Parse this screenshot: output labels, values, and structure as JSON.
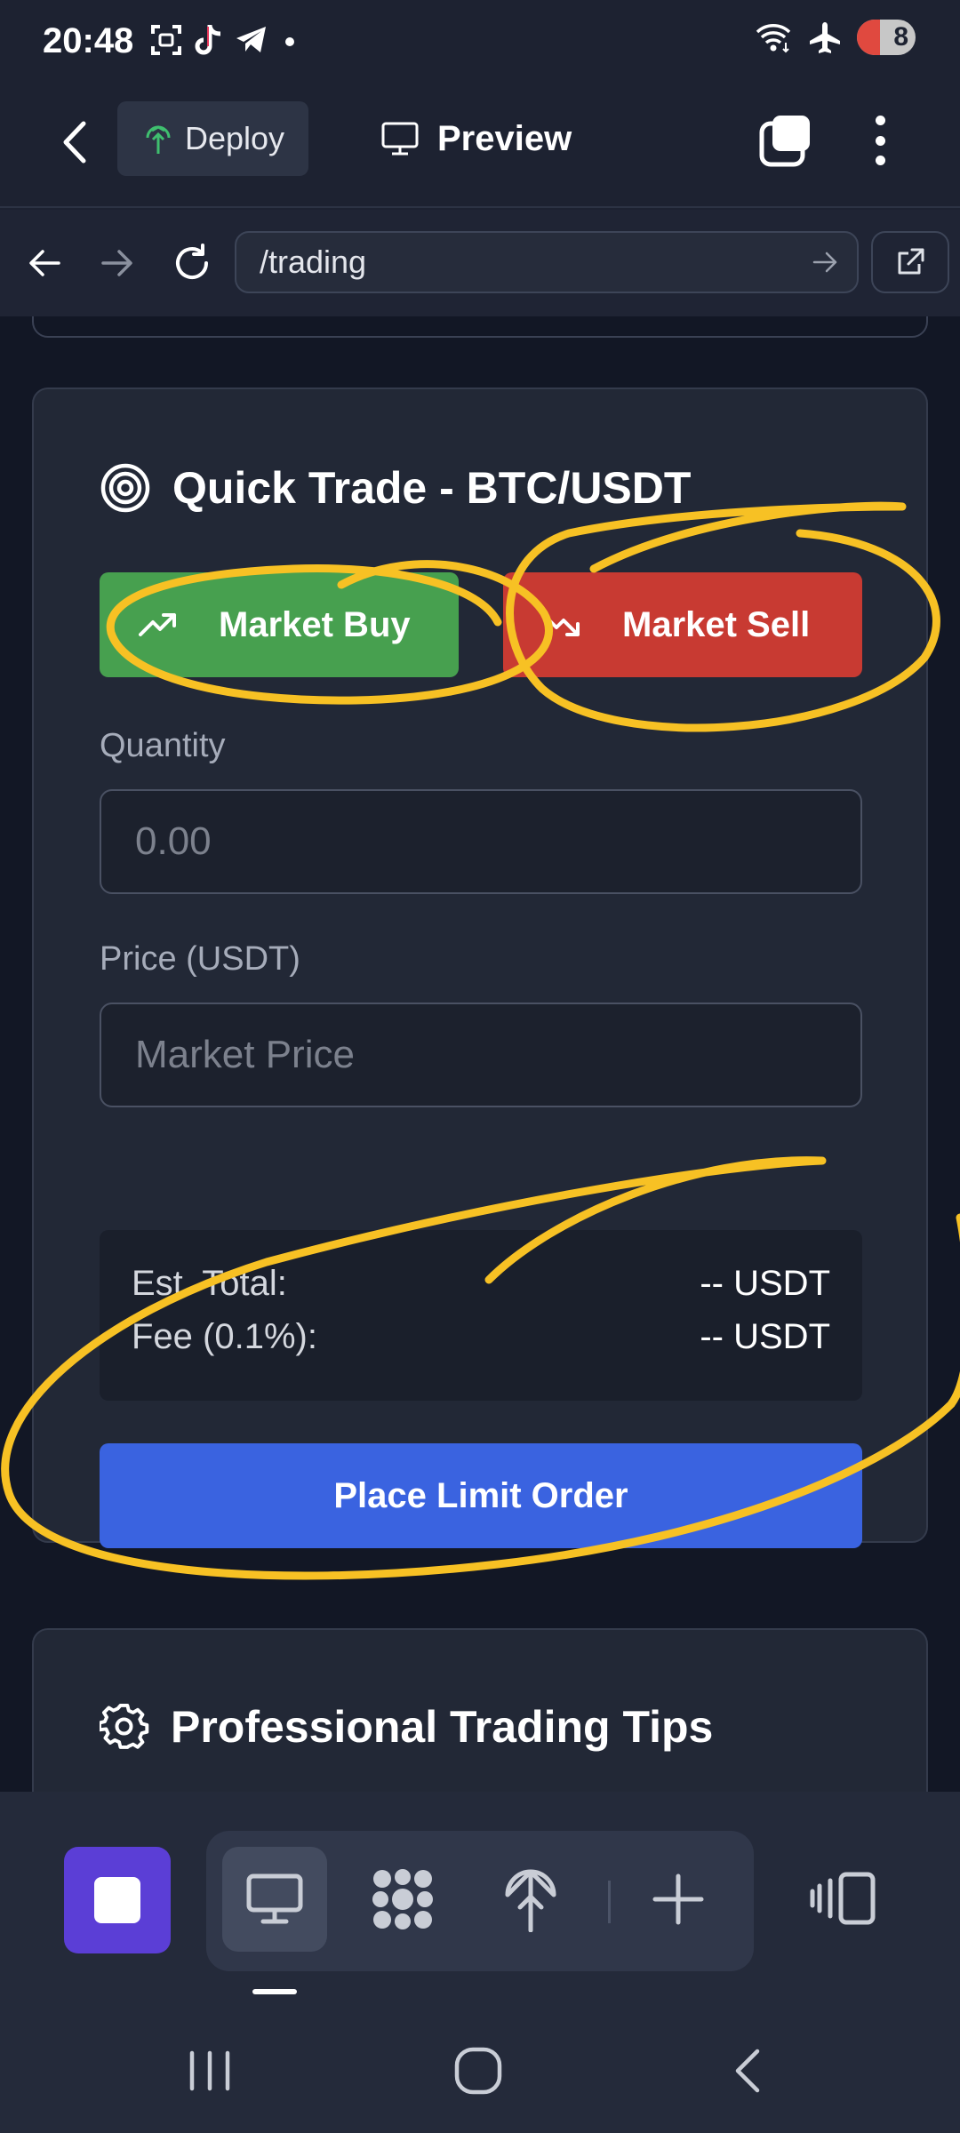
{
  "status_bar": {
    "time": "20:48",
    "battery_level": "8",
    "left_icons": [
      "screenshot-icon",
      "tiktok-icon",
      "telegram-icon",
      "dot-icon"
    ],
    "right_icons": [
      "wifi-icon",
      "airplane-icon",
      "battery-icon"
    ]
  },
  "app_header": {
    "deploy_label": "Deploy",
    "preview_label": "Preview",
    "accent_color": "#3fbf6f"
  },
  "url_bar": {
    "url": "/trading"
  },
  "quick_trade": {
    "title": "Quick Trade - BTC/USDT",
    "market_buy_label": "Market Buy",
    "market_sell_label": "Market Sell",
    "quantity_label": "Quantity",
    "quantity_placeholder": "0.00",
    "price_label": "Price (USDT)",
    "price_placeholder": "Market Price",
    "est_total_label": "Est. Total:",
    "est_total_value": "-- USDT",
    "fee_label": "Fee (0.1%):",
    "fee_value": "-- USDT",
    "place_order_label": "Place Limit Order",
    "buy_color": "#47a04f",
    "sell_color": "#c83a32",
    "order_color": "#3a63e0"
  },
  "tips": {
    "title": "Professional Trading Tips"
  },
  "bottom_toolbar": {
    "tools": [
      "desktop-icon",
      "dots-grid-icon",
      "deploy-icon",
      "plus-icon"
    ],
    "active_tool": "desktop-icon",
    "stop_color": "#5b3ed6"
  },
  "annotation_color": "#f7c124"
}
